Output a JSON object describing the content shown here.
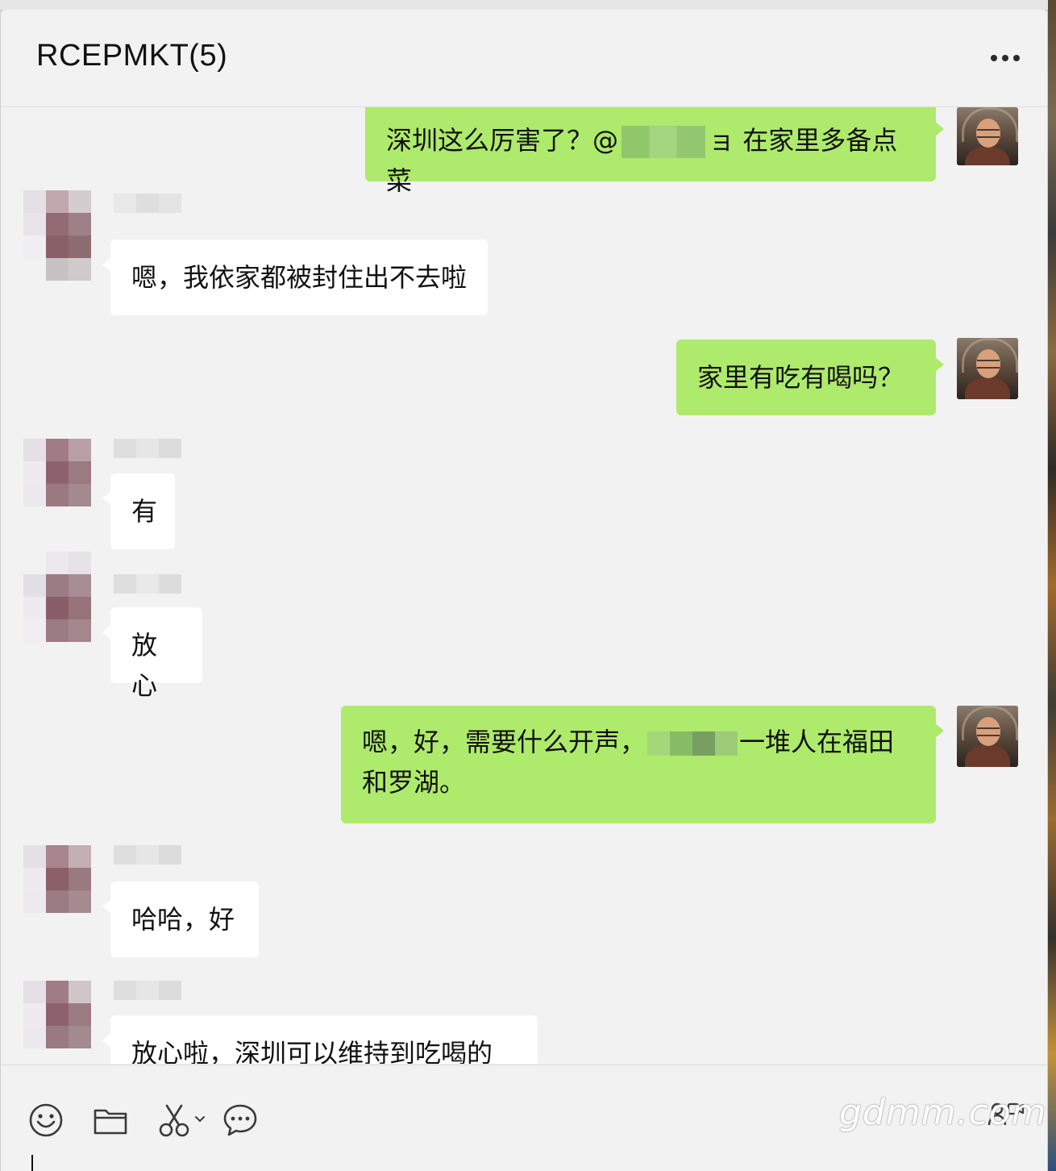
{
  "window": {
    "title": "RCEPMKT(5)"
  },
  "messages": [
    {
      "from": "self",
      "parts": [
        "深圳这么厉害了？@",
        "",
        "ョ 在家里多备点菜"
      ]
    },
    {
      "from": "other",
      "text": "嗯，我依家都被封住出不去啦"
    },
    {
      "from": "self",
      "text": "家里有吃有喝吗？"
    },
    {
      "from": "other",
      "text": "有"
    },
    {
      "from": "other",
      "text": "放心"
    },
    {
      "from": "self",
      "line1_a": "嗯，好，需要什么开声，",
      "line1_b": "一堆人在福田",
      "line2": "和罗湖。"
    },
    {
      "from": "other",
      "text": "哈哈，好"
    },
    {
      "from": "other",
      "text": "放心啦，深圳可以维持到吃喝的"
    }
  ],
  "toolbar": {
    "icons": [
      "emoji-icon",
      "folder-icon",
      "scissors-icon",
      "chat-history-icon",
      "video-call-icon"
    ]
  },
  "watermark": "gdmm.com"
}
